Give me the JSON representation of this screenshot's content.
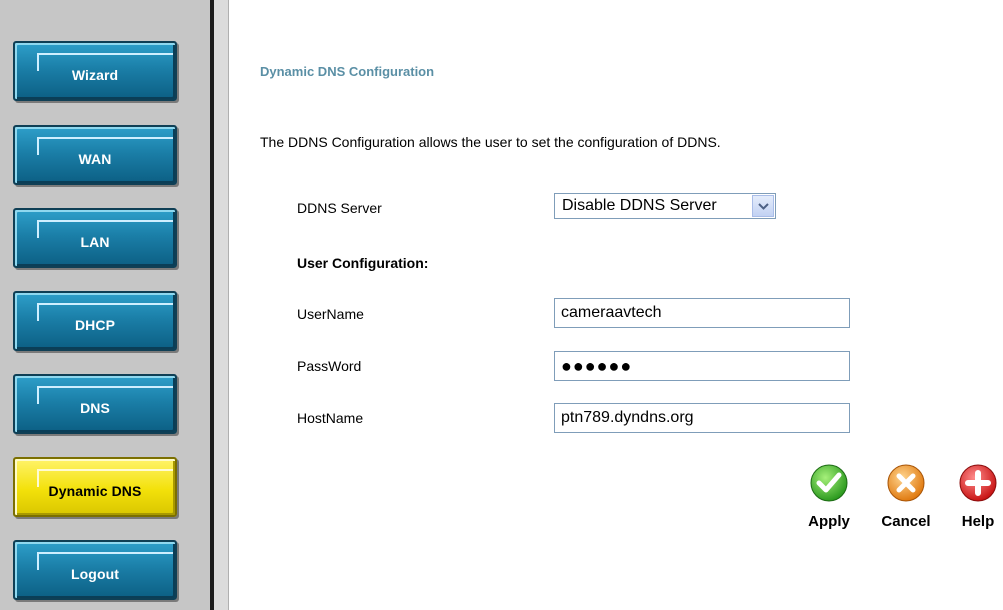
{
  "sidebar": {
    "items": [
      {
        "label": "Wizard",
        "active": false
      },
      {
        "label": "WAN",
        "active": false
      },
      {
        "label": "LAN",
        "active": false
      },
      {
        "label": "DHCP",
        "active": false
      },
      {
        "label": "DNS",
        "active": false
      },
      {
        "label": "Dynamic DNS",
        "active": true
      },
      {
        "label": "Logout",
        "active": false
      }
    ]
  },
  "main": {
    "section_title": "Dynamic DNS Configuration",
    "intro": "The DDNS Configuration allows the user to set the configuration of DDNS.",
    "ddns_server": {
      "label": "DDNS Server",
      "value": "Disable DDNS Server"
    },
    "user_config_heading": "User Configuration:",
    "username": {
      "label": "UserName",
      "value": "cameraavtech"
    },
    "password": {
      "label": "PassWord",
      "value": "●●●●●●"
    },
    "hostname": {
      "label": "HostName",
      "value": "ptn789.dyndns.org"
    }
  },
  "actions": {
    "apply": {
      "label": "Apply",
      "icon": "check-icon",
      "color": "#36a82a"
    },
    "cancel": {
      "label": "Cancel",
      "icon": "x-icon",
      "color": "#e38a1c"
    },
    "help": {
      "label": "Help",
      "icon": "plus-icon",
      "color": "#d91c1c"
    }
  },
  "colors": {
    "nav_blue": "#1b7fa8",
    "nav_active_yellow": "#f3e10a",
    "section_title": "#5a8fa5"
  }
}
